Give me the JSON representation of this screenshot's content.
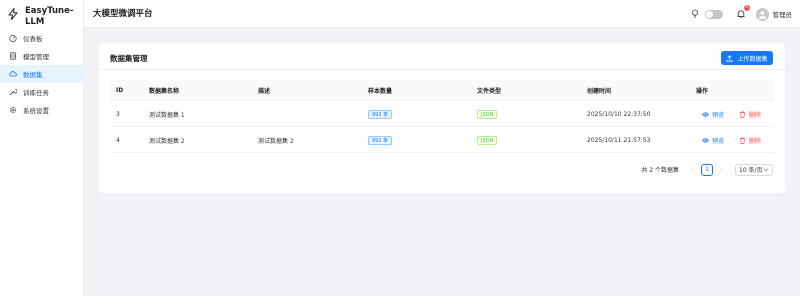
{
  "brand": {
    "name": "EasyTune-LLM"
  },
  "header": {
    "title": "大模型微调平台",
    "notification_count": "5",
    "user": "管理员"
  },
  "sidebar": {
    "items": [
      {
        "label": "仪表板",
        "icon": "dashboard-icon",
        "active": false
      },
      {
        "label": "模型管理",
        "icon": "database-icon",
        "active": false
      },
      {
        "label": "数据集",
        "icon": "cloud-icon",
        "active": true
      },
      {
        "label": "训练任务",
        "icon": "wrench-icon",
        "active": false
      },
      {
        "label": "系统设置",
        "icon": "gear-icon",
        "active": false
      }
    ]
  },
  "card": {
    "title": "数据集管理",
    "upload_label": "上传数据集"
  },
  "table": {
    "columns": [
      "ID",
      "数据集名称",
      "描述",
      "样本数量",
      "文件类型",
      "创建时间",
      "操作"
    ],
    "rows": [
      {
        "id": "3",
        "name": "测试数据集 1",
        "desc": "",
        "count": "992 条",
        "type": "JSON",
        "created": "2025/10/10 22:37:50"
      },
      {
        "id": "4",
        "name": "测试数据集 2",
        "desc": "测试数据集 2",
        "count": "992 条",
        "type": "JSON",
        "created": "2025/10/11 21:57:53"
      }
    ],
    "actions": {
      "view": "预览",
      "delete": "删除"
    }
  },
  "pagination": {
    "total_text": "共 2 个数据集",
    "current_page": "1",
    "page_size": "10 条/页"
  },
  "colors": {
    "primary": "#1677ff",
    "danger": "#ff4d4f",
    "success": "#52c41a"
  }
}
